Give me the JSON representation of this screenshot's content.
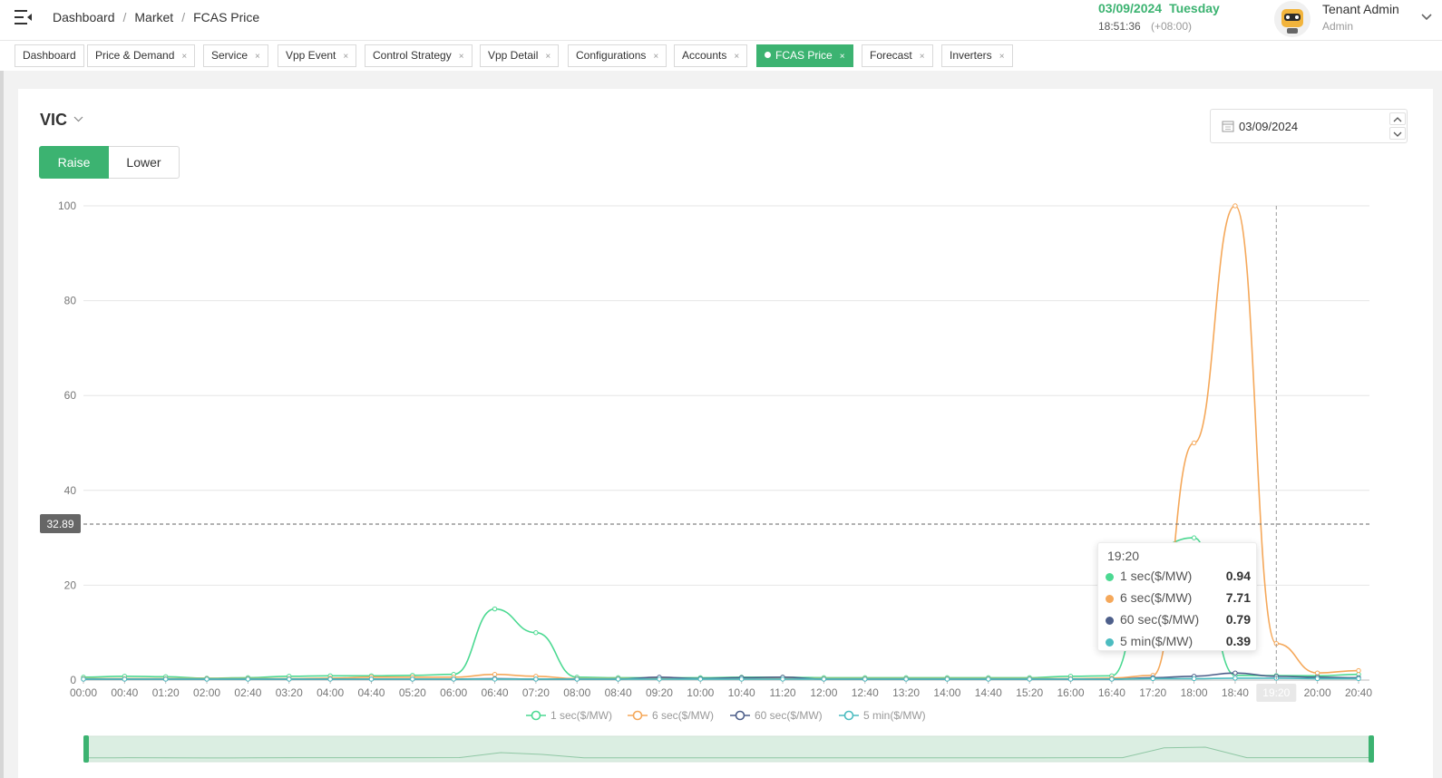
{
  "header": {
    "breadcrumb": [
      "Dashboard",
      "Market",
      "FCAS Price"
    ],
    "date": "03/09/2024",
    "weekday": "Tuesday",
    "time": "18:51:36",
    "timezone": "(+08:00)",
    "user_name": "Tenant Admin",
    "user_role": "Admin"
  },
  "tabs": [
    {
      "label": "Dashboard",
      "closable": false,
      "active": false
    },
    {
      "label": "Price & Demand",
      "closable": true,
      "active": false
    },
    {
      "label": "Service",
      "closable": true,
      "active": false
    },
    {
      "label": "Vpp Event",
      "closable": true,
      "active": false
    },
    {
      "label": "Control Strategy",
      "closable": true,
      "active": false
    },
    {
      "label": "Vpp Detail",
      "closable": true,
      "active": false
    },
    {
      "label": "Configurations",
      "closable": true,
      "active": false
    },
    {
      "label": "Accounts",
      "closable": true,
      "active": false
    },
    {
      "label": "FCAS Price",
      "closable": true,
      "active": true
    },
    {
      "label": "Forecast",
      "closable": true,
      "active": false
    },
    {
      "label": "Inverters",
      "closable": true,
      "active": false
    }
  ],
  "close_glyph": "×",
  "filters": {
    "region": "VIC",
    "direction_options": [
      "Raise",
      "Lower"
    ],
    "direction_selected": "Raise",
    "date": "03/09/2024"
  },
  "colors": {
    "accent": "#3cb371",
    "series_1sec": "#4cd992",
    "series_6sec": "#f5a85a",
    "series_60sec": "#4d5f8a",
    "series_5min": "#4cbcc0"
  },
  "chart_data": {
    "type": "line",
    "x": [
      "00:00",
      "00:40",
      "01:20",
      "02:00",
      "02:40",
      "03:20",
      "04:00",
      "04:40",
      "05:20",
      "06:00",
      "06:40",
      "07:20",
      "08:00",
      "08:40",
      "09:20",
      "10:00",
      "10:40",
      "11:20",
      "12:00",
      "12:40",
      "13:20",
      "14:00",
      "14:40",
      "15:20",
      "16:00",
      "16:40",
      "17:20",
      "18:00",
      "18:40",
      "19:20",
      "20:00",
      "20:40"
    ],
    "ylim": [
      0,
      100
    ],
    "yticks": [
      0,
      20,
      40,
      60,
      80,
      100
    ],
    "crosshair_y": 32.89,
    "crosshair_x": "19:20",
    "grid": true,
    "legend_position": "bottom",
    "series": [
      {
        "name": "1 sec($/MW)",
        "values": [
          0.6,
          0.8,
          0.7,
          0.4,
          0.5,
          0.8,
          0.9,
          0.9,
          1.0,
          1.2,
          15,
          10,
          0.6,
          0.5,
          0.5,
          0.5,
          0.6,
          0.6,
          0.5,
          0.5,
          0.5,
          0.5,
          0.5,
          0.5,
          0.8,
          0.9,
          28,
          30,
          1.0,
          0.94,
          0.9,
          1.2
        ]
      },
      {
        "name": "6 sec($/MW)",
        "values": [
          0.3,
          0.3,
          0.3,
          0.3,
          0.3,
          0.3,
          0.4,
          0.6,
          0.6,
          0.6,
          1.2,
          0.8,
          0.3,
          0.3,
          0.3,
          0.3,
          0.3,
          0.3,
          0.3,
          0.3,
          0.3,
          0.3,
          0.3,
          0.3,
          0.3,
          0.4,
          1.0,
          50,
          100,
          7.71,
          1.5,
          2.0
        ]
      },
      {
        "name": "60 sec($/MW)",
        "values": [
          0.2,
          0.2,
          0.2,
          0.2,
          0.2,
          0.2,
          0.2,
          0.2,
          0.2,
          0.2,
          0.3,
          0.2,
          0.2,
          0.2,
          0.6,
          0.3,
          0.5,
          0.6,
          0.2,
          0.2,
          0.2,
          0.2,
          0.2,
          0.2,
          0.2,
          0.2,
          0.5,
          0.8,
          1.5,
          0.79,
          0.6,
          0.5
        ]
      },
      {
        "name": "5 min($/MW)",
        "values": [
          0.2,
          0.2,
          0.2,
          0.2,
          0.2,
          0.2,
          0.2,
          0.2,
          0.2,
          0.2,
          0.2,
          0.2,
          0.2,
          0.2,
          0.2,
          0.2,
          0.2,
          0.2,
          0.2,
          0.2,
          0.2,
          0.2,
          0.2,
          0.2,
          0.2,
          0.2,
          0.3,
          0.3,
          0.4,
          0.39,
          0.3,
          0.3
        ]
      }
    ]
  },
  "tooltip": {
    "time": "19:20",
    "rows": [
      {
        "label": "1 sec($/MW)",
        "value": "0.94"
      },
      {
        "label": "6 sec($/MW)",
        "value": "7.71"
      },
      {
        "label": "60 sec($/MW)",
        "value": "0.79"
      },
      {
        "label": "5 min($/MW)",
        "value": "0.39"
      }
    ]
  }
}
